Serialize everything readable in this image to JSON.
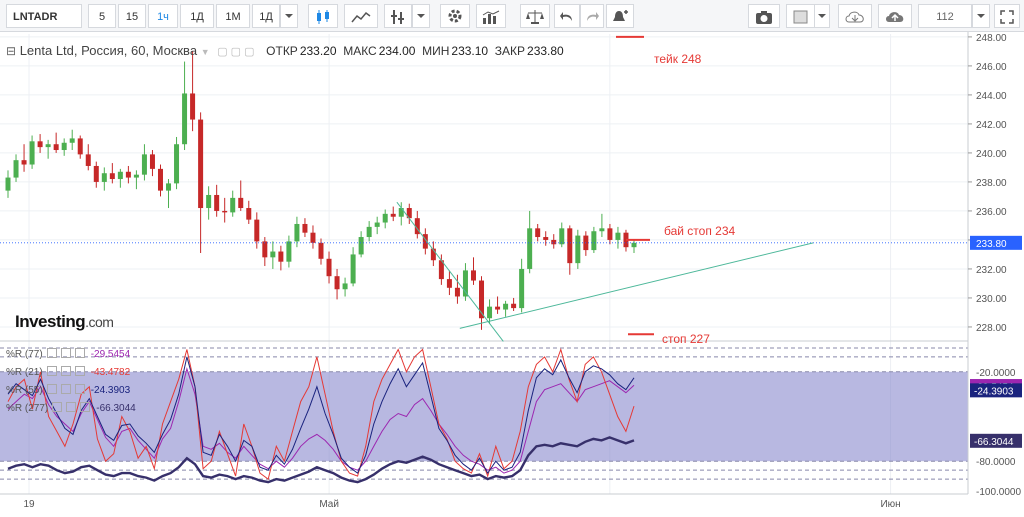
{
  "toolbar": {
    "symbol": "LNTADR",
    "intervals": [
      "5",
      "15",
      "1ч",
      "1Д",
      "1М",
      "1Д"
    ],
    "active_interval": "1ч",
    "right_value": "112"
  },
  "legend": {
    "title": "Lenta Ltd, Россия, 60, Москва",
    "open_label": "ОТКР",
    "open": "233.20",
    "high_label": "МАКС",
    "high": "234.00",
    "low_label": "МИН",
    "low": "233.10",
    "close_label": "ЗАКР",
    "close": "233.80"
  },
  "logo": {
    "brand": "Investing",
    "suffix": ".com"
  },
  "notes": {
    "take": "тейк 248",
    "buy_stop": "бай стоп 234",
    "stop": "стоп 227"
  },
  "indicators": [
    {
      "label": "%R (77)",
      "value": "-29.5454",
      "color": "#9c27b0"
    },
    {
      "label": "%R (21)",
      "value": "-43.4782",
      "color": "#e53935"
    },
    {
      "label": "%R (55)",
      "value": "-24.3903",
      "color": "#1a237e"
    },
    {
      "label": "%R (277)",
      "value": "-66.3044",
      "color": "#37306b"
    }
  ],
  "colors": {
    "up": "#4caf50",
    "down": "#c62828",
    "trend": "#4db89a",
    "grid": "#edf0f4",
    "band": "#7e7ec8",
    "last_price_tag": "#2962ff"
  },
  "chart_data": {
    "type": "candlestick",
    "price_axis": {
      "ticks": [
        "248.00",
        "246.00",
        "244.00",
        "242.00",
        "240.00",
        "238.00",
        "236.00",
        "234.00",
        "232.00",
        "230.00",
        "228.00"
      ],
      "range": [
        227.1,
        248.2
      ],
      "last_price": "233.80"
    },
    "oscillator_axis": {
      "ticks": [
        "-20.0000",
        "-80.0000",
        "-100.0000"
      ],
      "range": [
        -102,
        0
      ]
    },
    "x_labels": [
      "19",
      "Май",
      "Июн"
    ],
    "candles": [
      {
        "o": 237.4,
        "h": 238.8,
        "l": 236.9,
        "c": 238.3
      },
      {
        "o": 238.3,
        "h": 239.9,
        "l": 238.0,
        "c": 239.5
      },
      {
        "o": 239.5,
        "h": 240.6,
        "l": 238.7,
        "c": 239.2
      },
      {
        "o": 239.2,
        "h": 241.2,
        "l": 238.9,
        "c": 240.8
      },
      {
        "o": 240.8,
        "h": 241.3,
        "l": 240.0,
        "c": 240.4
      },
      {
        "o": 240.4,
        "h": 240.9,
        "l": 239.6,
        "c": 240.6
      },
      {
        "o": 240.6,
        "h": 241.4,
        "l": 240.0,
        "c": 240.2
      },
      {
        "o": 240.2,
        "h": 241.0,
        "l": 239.8,
        "c": 240.7
      },
      {
        "o": 240.7,
        "h": 241.6,
        "l": 240.2,
        "c": 241.0
      },
      {
        "o": 241.0,
        "h": 241.2,
        "l": 239.6,
        "c": 239.9
      },
      {
        "o": 239.9,
        "h": 240.6,
        "l": 238.8,
        "c": 239.1
      },
      {
        "o": 239.1,
        "h": 239.4,
        "l": 237.6,
        "c": 238.0
      },
      {
        "o": 238.0,
        "h": 239.0,
        "l": 237.4,
        "c": 238.6
      },
      {
        "o": 238.6,
        "h": 239.3,
        "l": 237.9,
        "c": 238.2
      },
      {
        "o": 238.2,
        "h": 238.9,
        "l": 237.6,
        "c": 238.7
      },
      {
        "o": 238.7,
        "h": 239.1,
        "l": 237.9,
        "c": 238.3
      },
      {
        "o": 238.3,
        "h": 238.8,
        "l": 237.5,
        "c": 238.5
      },
      {
        "o": 238.5,
        "h": 240.6,
        "l": 238.1,
        "c": 239.9
      },
      {
        "o": 239.9,
        "h": 240.2,
        "l": 238.4,
        "c": 238.9
      },
      {
        "o": 238.9,
        "h": 239.2,
        "l": 237.0,
        "c": 237.4
      },
      {
        "o": 237.4,
        "h": 238.2,
        "l": 236.2,
        "c": 237.9
      },
      {
        "o": 237.9,
        "h": 241.1,
        "l": 237.5,
        "c": 240.6
      },
      {
        "o": 240.6,
        "h": 246.3,
        "l": 240.2,
        "c": 244.1
      },
      {
        "o": 244.1,
        "h": 247.0,
        "l": 241.5,
        "c": 242.3
      },
      {
        "o": 242.3,
        "h": 242.8,
        "l": 233.1,
        "c": 236.2
      },
      {
        "o": 236.2,
        "h": 237.7,
        "l": 235.4,
        "c": 237.1
      },
      {
        "o": 237.1,
        "h": 237.8,
        "l": 235.6,
        "c": 236.0
      },
      {
        "o": 236.0,
        "h": 236.9,
        "l": 235.2,
        "c": 235.9
      },
      {
        "o": 235.9,
        "h": 237.4,
        "l": 235.6,
        "c": 236.9
      },
      {
        "o": 236.9,
        "h": 238.1,
        "l": 236.0,
        "c": 236.2
      },
      {
        "o": 236.2,
        "h": 236.7,
        "l": 235.1,
        "c": 235.4
      },
      {
        "o": 235.4,
        "h": 235.9,
        "l": 233.4,
        "c": 233.9
      },
      {
        "o": 233.9,
        "h": 234.2,
        "l": 232.2,
        "c": 232.8
      },
      {
        "o": 232.8,
        "h": 233.9,
        "l": 232.0,
        "c": 233.2
      },
      {
        "o": 233.2,
        "h": 233.6,
        "l": 231.9,
        "c": 232.5
      },
      {
        "o": 232.5,
        "h": 234.3,
        "l": 232.1,
        "c": 233.9
      },
      {
        "o": 233.9,
        "h": 235.6,
        "l": 233.5,
        "c": 235.1
      },
      {
        "o": 235.1,
        "h": 235.5,
        "l": 234.2,
        "c": 234.5
      },
      {
        "o": 234.5,
        "h": 235.0,
        "l": 233.4,
        "c": 233.8
      },
      {
        "o": 233.8,
        "h": 234.1,
        "l": 232.3,
        "c": 232.7
      },
      {
        "o": 232.7,
        "h": 233.2,
        "l": 231.0,
        "c": 231.5
      },
      {
        "o": 231.5,
        "h": 232.0,
        "l": 229.9,
        "c": 230.6
      },
      {
        "o": 230.6,
        "h": 231.4,
        "l": 230.1,
        "c": 231.0
      },
      {
        "o": 231.0,
        "h": 233.5,
        "l": 230.8,
        "c": 233.0
      },
      {
        "o": 233.0,
        "h": 234.6,
        "l": 232.8,
        "c": 234.2
      },
      {
        "o": 234.2,
        "h": 235.3,
        "l": 233.9,
        "c": 234.9
      },
      {
        "o": 234.9,
        "h": 235.6,
        "l": 234.4,
        "c": 235.2
      },
      {
        "o": 235.2,
        "h": 236.1,
        "l": 234.8,
        "c": 235.8
      },
      {
        "o": 235.8,
        "h": 236.3,
        "l": 235.3,
        "c": 235.6
      },
      {
        "o": 235.6,
        "h": 236.6,
        "l": 235.0,
        "c": 236.2
      },
      {
        "o": 236.2,
        "h": 236.5,
        "l": 235.1,
        "c": 235.5
      },
      {
        "o": 235.5,
        "h": 236.0,
        "l": 234.1,
        "c": 234.4
      },
      {
        "o": 234.4,
        "h": 234.8,
        "l": 233.0,
        "c": 233.4
      },
      {
        "o": 233.4,
        "h": 233.9,
        "l": 232.2,
        "c": 232.6
      },
      {
        "o": 232.6,
        "h": 233.0,
        "l": 230.9,
        "c": 231.3
      },
      {
        "o": 231.3,
        "h": 231.9,
        "l": 230.2,
        "c": 230.7
      },
      {
        "o": 230.7,
        "h": 231.6,
        "l": 229.6,
        "c": 230.1
      },
      {
        "o": 230.1,
        "h": 232.4,
        "l": 229.8,
        "c": 231.9
      },
      {
        "o": 231.9,
        "h": 232.8,
        "l": 230.9,
        "c": 231.2
      },
      {
        "o": 231.2,
        "h": 231.5,
        "l": 227.8,
        "c": 228.6
      },
      {
        "o": 228.6,
        "h": 229.9,
        "l": 228.2,
        "c": 229.4
      },
      {
        "o": 229.4,
        "h": 230.1,
        "l": 228.9,
        "c": 229.2
      },
      {
        "o": 229.2,
        "h": 229.8,
        "l": 228.7,
        "c": 229.6
      },
      {
        "o": 229.6,
        "h": 230.0,
        "l": 229.1,
        "c": 229.3
      },
      {
        "o": 229.3,
        "h": 232.7,
        "l": 229.0,
        "c": 232.0
      },
      {
        "o": 232.0,
        "h": 236.0,
        "l": 231.7,
        "c": 234.8
      },
      {
        "o": 234.8,
        "h": 235.1,
        "l": 233.9,
        "c": 234.2
      },
      {
        "o": 234.2,
        "h": 234.6,
        "l": 233.6,
        "c": 234.0
      },
      {
        "o": 234.0,
        "h": 234.4,
        "l": 233.4,
        "c": 233.7
      },
      {
        "o": 233.7,
        "h": 235.2,
        "l": 233.5,
        "c": 234.8
      },
      {
        "o": 234.8,
        "h": 235.0,
        "l": 231.6,
        "c": 232.4
      },
      {
        "o": 232.4,
        "h": 234.7,
        "l": 232.0,
        "c": 234.3
      },
      {
        "o": 234.3,
        "h": 234.6,
        "l": 232.9,
        "c": 233.3
      },
      {
        "o": 233.3,
        "h": 234.9,
        "l": 233.1,
        "c": 234.6
      },
      {
        "o": 234.6,
        "h": 235.8,
        "l": 234.2,
        "c": 234.8
      },
      {
        "o": 234.8,
        "h": 235.1,
        "l": 233.7,
        "c": 234.0
      },
      {
        "o": 234.0,
        "h": 234.9,
        "l": 233.4,
        "c": 234.5
      },
      {
        "o": 234.5,
        "h": 234.7,
        "l": 233.2,
        "c": 233.5
      },
      {
        "o": 233.5,
        "h": 234.0,
        "l": 233.1,
        "c": 233.8
      }
    ],
    "trendlines": [
      {
        "name": "falling",
        "from": [
          0.41,
          236.6
        ],
        "to": [
          0.52,
          227.0
        ]
      },
      {
        "name": "rising",
        "from": [
          0.475,
          227.9
        ],
        "to": [
          0.84,
          233.8
        ]
      }
    ],
    "levels": [
      {
        "name": "take",
        "value": 248.0
      },
      {
        "name": "buy-stop",
        "value": 234.0
      },
      {
        "name": "stop",
        "value": 227.5
      }
    ],
    "oscillators": [
      {
        "name": "%R (77)",
        "color": "#9c27b0",
        "values": [
          -45,
          -40,
          -35,
          -38,
          -30,
          -42,
          -50,
          -55,
          -60,
          -48,
          -40,
          -52,
          -64,
          -70,
          -60,
          -58,
          -66,
          -72,
          -78,
          -65,
          -58,
          -40,
          -18,
          -35,
          -70,
          -72,
          -68,
          -74,
          -78,
          -70,
          -76,
          -82,
          -85,
          -80,
          -84,
          -78,
          -70,
          -65,
          -62,
          -66,
          -72,
          -80,
          -84,
          -86,
          -80,
          -70,
          -60,
          -52,
          -48,
          -50,
          -42,
          -38,
          -46,
          -55,
          -62,
          -70,
          -76,
          -80,
          -82,
          -86,
          -84,
          -88,
          -86,
          -80,
          -60,
          -40,
          -32,
          -30,
          -28,
          -34,
          -40,
          -32,
          -30,
          -28,
          -26,
          -30,
          -34,
          -29
        ]
      },
      {
        "name": "%R (21)",
        "color": "#e53935",
        "values": [
          -40,
          -30,
          -25,
          -45,
          -20,
          -50,
          -60,
          -70,
          -55,
          -35,
          -30,
          -65,
          -80,
          -75,
          -50,
          -60,
          -78,
          -70,
          -85,
          -55,
          -40,
          -25,
          -5,
          -30,
          -85,
          -80,
          -60,
          -75,
          -90,
          -55,
          -70,
          -88,
          -92,
          -70,
          -80,
          -60,
          -40,
          -30,
          -10,
          -35,
          -60,
          -80,
          -88,
          -90,
          -70,
          -40,
          -25,
          -15,
          -5,
          -20,
          -10,
          -5,
          -30,
          -55,
          -65,
          -80,
          -85,
          -88,
          -75,
          -90,
          -70,
          -85,
          -80,
          -60,
          -30,
          -15,
          -10,
          -20,
          -5,
          -25,
          -40,
          -15,
          -10,
          -20,
          -35,
          -50,
          -60,
          -43
        ]
      },
      {
        "name": "%R (55)",
        "color": "#1a237e",
        "values": [
          -35,
          -28,
          -32,
          -36,
          -25,
          -38,
          -48,
          -58,
          -62,
          -46,
          -38,
          -50,
          -62,
          -66,
          -56,
          -55,
          -63,
          -68,
          -74,
          -62,
          -52,
          -35,
          -10,
          -30,
          -74,
          -76,
          -62,
          -70,
          -80,
          -66,
          -70,
          -84,
          -86,
          -76,
          -82,
          -72,
          -58,
          -45,
          -30,
          -48,
          -62,
          -78,
          -84,
          -88,
          -76,
          -55,
          -40,
          -28,
          -18,
          -30,
          -22,
          -14,
          -36,
          -58,
          -66,
          -76,
          -82,
          -86,
          -78,
          -88,
          -80,
          -86,
          -84,
          -74,
          -46,
          -24,
          -18,
          -22,
          -12,
          -24,
          -34,
          -20,
          -16,
          -18,
          -22,
          -28,
          -32,
          -24
        ]
      },
      {
        "name": "%R (277)",
        "color": "#37306b",
        "values": [
          -85,
          -83,
          -82,
          -84,
          -82,
          -83,
          -86,
          -88,
          -87,
          -84,
          -83,
          -86,
          -89,
          -90,
          -88,
          -88,
          -90,
          -91,
          -93,
          -90,
          -88,
          -84,
          -78,
          -82,
          -90,
          -91,
          -89,
          -90,
          -92,
          -90,
          -91,
          -93,
          -94,
          -92,
          -93,
          -91,
          -89,
          -87,
          -84,
          -86,
          -88,
          -91,
          -93,
          -94,
          -92,
          -89,
          -85,
          -82,
          -80,
          -81,
          -79,
          -77,
          -79,
          -82,
          -84,
          -86,
          -88,
          -90,
          -89,
          -92,
          -90,
          -91,
          -90,
          -86,
          -76,
          -70,
          -69,
          -70,
          -68,
          -69,
          -70,
          -67,
          -65,
          -66,
          -64,
          -66,
          -68,
          -66
        ]
      }
    ]
  }
}
